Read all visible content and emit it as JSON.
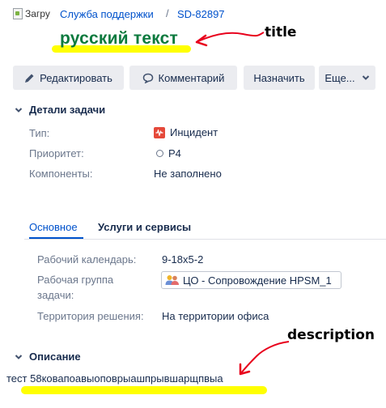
{
  "breadcrumb": {
    "broken_image_alt": "Загру",
    "project_link": "Служба поддержки",
    "separator": "/",
    "issue_key": "SD-82897"
  },
  "issue": {
    "title": "русский текст"
  },
  "annotations": {
    "title_label": "title",
    "description_label": "description",
    "highlight_color": "#ffff00",
    "arrow_color": "#e8001c"
  },
  "toolbar": {
    "edit_label": "Редактировать",
    "comment_label": "Комментарий",
    "assign_label": "Назначить",
    "more_label": "Еще..."
  },
  "details": {
    "section_title": "Детали задачи",
    "type_label": "Тип:",
    "type_value": "Инцидент",
    "priority_label": "Приоритет:",
    "priority_value": "P4",
    "components_label": "Компоненты:",
    "components_value": "Не заполнено"
  },
  "tabs": [
    {
      "label": "Основное",
      "active": true
    },
    {
      "label": "Услуги и сервисы",
      "active": false
    }
  ],
  "main_tab": {
    "calendar_label": "Рабочий календарь:",
    "calendar_value": "9-18x5-2",
    "workgroup_label_line1": "Рабочая группа",
    "workgroup_label_line2": "задачи:",
    "workgroup_value": "ЦО - Сопровождение HPSM_1",
    "territory_label": "Территория решения:",
    "territory_value": "На территории офиса"
  },
  "description": {
    "section_title": "Описание",
    "text": "тест 58ковапоавыоповрыашпрывшарщпвыа"
  },
  "colors": {
    "link": "#0052cc",
    "title": "#0c7a3e",
    "button_bg": "#ebecf0",
    "incident": "#e5493a"
  }
}
